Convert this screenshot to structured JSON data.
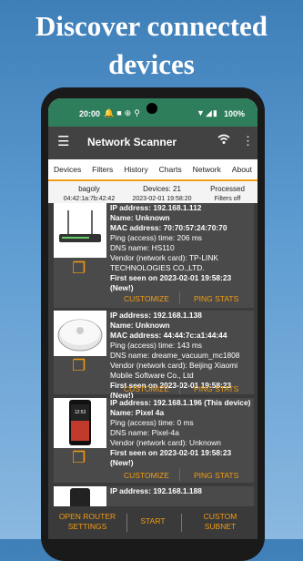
{
  "headline": {
    "line1": "Discover connected",
    "line2": "devices"
  },
  "status_bar": {
    "time": "20:00",
    "battery": "100%"
  },
  "app_bar": {
    "title": "Network Scanner"
  },
  "tabs": [
    "Devices",
    "Filters",
    "History",
    "Charts",
    "Network",
    "About"
  ],
  "info_row": {
    "name": "bagoly",
    "mac": "04:42:1a:7b:42:42",
    "devices": "Devices: 21",
    "date": "2023-02-01 19:58:20",
    "processed": "Processed",
    "filters": "Filters off"
  },
  "devices": [
    {
      "ip": "IP address: 192.168.1.112",
      "name": "Name: Unknown",
      "mac": "MAC address: 70:70:57:24:70:70",
      "ping": "Ping (access) time: 206  ms",
      "dns": "DNS name: HS110",
      "vendor": "Vendor (network card): TP-LINK TECHNOLOGIES CO.,LTD.",
      "seen": "First seen on 2023-02-01 19:58:23 (New!)",
      "customize": "CUSTOMIZE",
      "ping_stats": "PING STATS"
    },
    {
      "ip": "IP address: 192.168.1.138",
      "name": "Name: Unknown",
      "mac": "MAC address: 44:44:7c:a1:44:44",
      "ping": "Ping (access) time: 143  ms",
      "dns": "DNS name: dreame_vacuum_mc1808",
      "vendor": "Vendor (network card): Beijing Xiaomi Mobile Software Co., Ltd",
      "seen": "First seen on 2023-02-01 19:58:23 (New!)",
      "customize": "CUSTOMIZE",
      "ping_stats": "PING STATS"
    },
    {
      "ip": "IP address: 192.168.1.196 (This device)",
      "name": "Name: Pixel 4a",
      "ping": "Ping (access) time: 0  ms",
      "dns": "DNS name: Pixel-4a",
      "vendor": "Vendor (network card): Unknown",
      "seen": "First seen on 2023-02-01 19:58:23 (New!)",
      "customize": "CUSTOMIZE",
      "ping_stats": "PING STATS"
    },
    {
      "ip": "IP address: 192.168.1.188"
    }
  ],
  "phone_time": "12:53",
  "bottom_bar": {
    "router_line1": "OPEN ROUTER",
    "router_line2": "SETTINGS",
    "start": "START",
    "subnet_line1": "CUSTOM",
    "subnet_line2": "SUBNET"
  },
  "colors": {
    "accent": "#f39c12",
    "status_bar": "#2e7d5b",
    "app_bar": "#424242",
    "card": "#4a4a4a"
  }
}
